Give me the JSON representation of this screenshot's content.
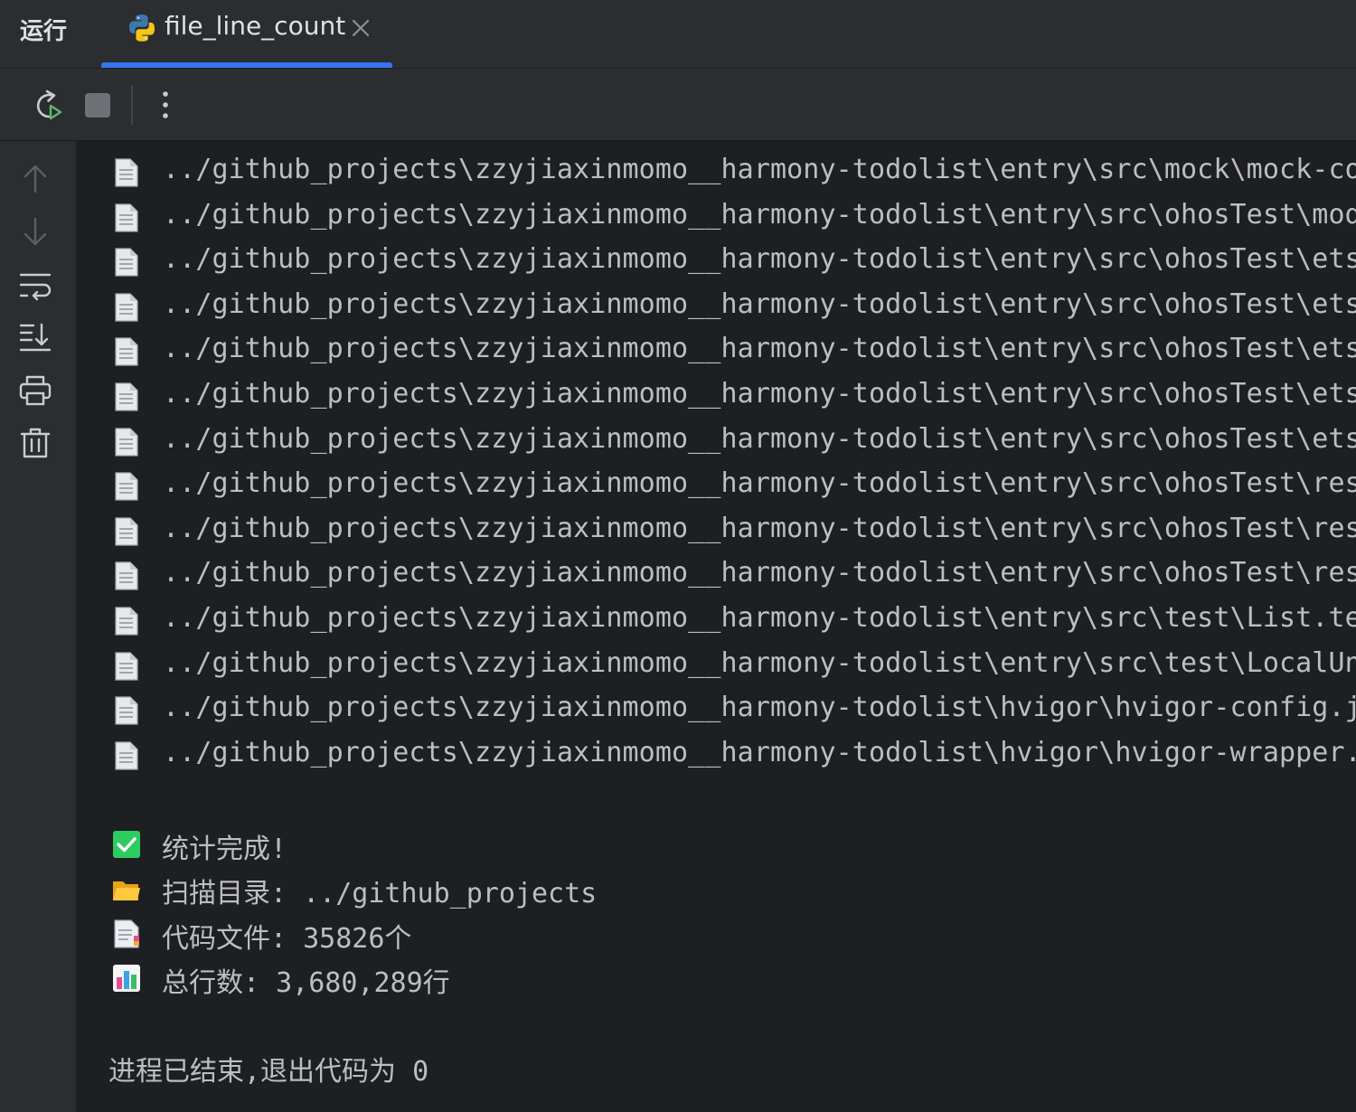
{
  "tool_window": {
    "title": "运行"
  },
  "run_tab": {
    "label": "file_line_count",
    "icon": "python-icon"
  },
  "toolbar": {
    "buttons": [
      "rerun-icon",
      "stop-icon",
      "more-options-icon"
    ]
  },
  "gutter": {
    "buttons": [
      "arrow-up-icon",
      "arrow-down-icon",
      "soft-wrap-icon",
      "scroll-to-end-icon",
      "print-icon",
      "trash-icon"
    ]
  },
  "console": {
    "file_lines": [
      "../github_projects\\zzyjiaxinmomo__harmony-todolist\\entry\\src\\mock\\mock-con",
      "../github_projects\\zzyjiaxinmomo__harmony-todolist\\entry\\src\\ohosTest\\modu",
      "../github_projects\\zzyjiaxinmomo__harmony-todolist\\entry\\src\\ohosTest\\ets\\",
      "../github_projects\\zzyjiaxinmomo__harmony-todolist\\entry\\src\\ohosTest\\ets\\",
      "../github_projects\\zzyjiaxinmomo__harmony-todolist\\entry\\src\\ohosTest\\ets\\",
      "../github_projects\\zzyjiaxinmomo__harmony-todolist\\entry\\src\\ohosTest\\ets\\",
      "../github_projects\\zzyjiaxinmomo__harmony-todolist\\entry\\src\\ohosTest\\ets\\",
      "../github_projects\\zzyjiaxinmomo__harmony-todolist\\entry\\src\\ohosTest\\reso",
      "../github_projects\\zzyjiaxinmomo__harmony-todolist\\entry\\src\\ohosTest\\reso",
      "../github_projects\\zzyjiaxinmomo__harmony-todolist\\entry\\src\\ohosTest\\reso",
      "../github_projects\\zzyjiaxinmomo__harmony-todolist\\entry\\src\\test\\List.tes",
      "../github_projects\\zzyjiaxinmomo__harmony-todolist\\entry\\src\\test\\LocalUni",
      "../github_projects\\zzyjiaxinmomo__harmony-todolist\\hvigor\\hvigor-config.js",
      "../github_projects\\zzyjiaxinmomo__harmony-todolist\\hvigor\\hvigor-wrapper.j"
    ],
    "summary": {
      "done": "统计完成!",
      "scan_dir": "扫描目录: ../github_projects",
      "code_files": "代码文件: 35826个",
      "total_lines": "总行数: 3,680,289行"
    },
    "exit_message": "进程已结束,退出代码为 0"
  },
  "colors": {
    "background": "#1e1f22",
    "panel": "#2b2d30",
    "accent": "#3574f0",
    "text": "#bcbec4",
    "success": "#2ed573"
  }
}
